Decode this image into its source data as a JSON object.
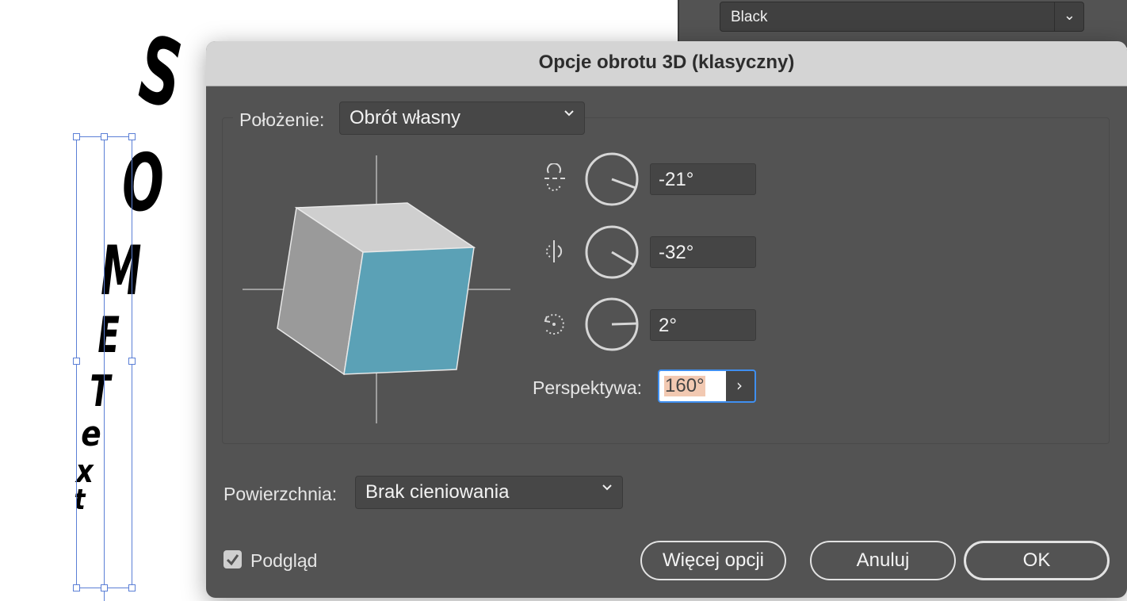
{
  "canvas": {
    "letters": [
      "S",
      "O",
      "M",
      "E",
      "T",
      "e",
      "x",
      "t"
    ]
  },
  "panel": {
    "color_select": {
      "value": "Black",
      "icon": "chevron-down-icon"
    }
  },
  "dialog": {
    "title": "Opcje obrotu 3D (klasyczny)",
    "position": {
      "label": "Położenie:",
      "value": "Obrót własny"
    },
    "cube_colors": {
      "top": "#cfcfcf",
      "left": "#9a9a9a",
      "front": "#5ba1b6"
    },
    "rotation": {
      "x": {
        "icon": "rotate-x-axis-icon",
        "value": "-21°"
      },
      "y": {
        "icon": "rotate-y-axis-icon",
        "value": "-32°"
      },
      "z": {
        "icon": "rotate-z-axis-icon",
        "value": "2°"
      }
    },
    "perspective": {
      "label": "Perspektywa:",
      "value": "160°"
    },
    "surface": {
      "label": "Powierzchnia:",
      "value": "Brak cieniowania"
    },
    "preview": {
      "label": "Podgląd",
      "checked": true
    },
    "buttons": {
      "more": "Więcej opcji",
      "cancel": "Anuluj",
      "ok": "OK"
    }
  }
}
